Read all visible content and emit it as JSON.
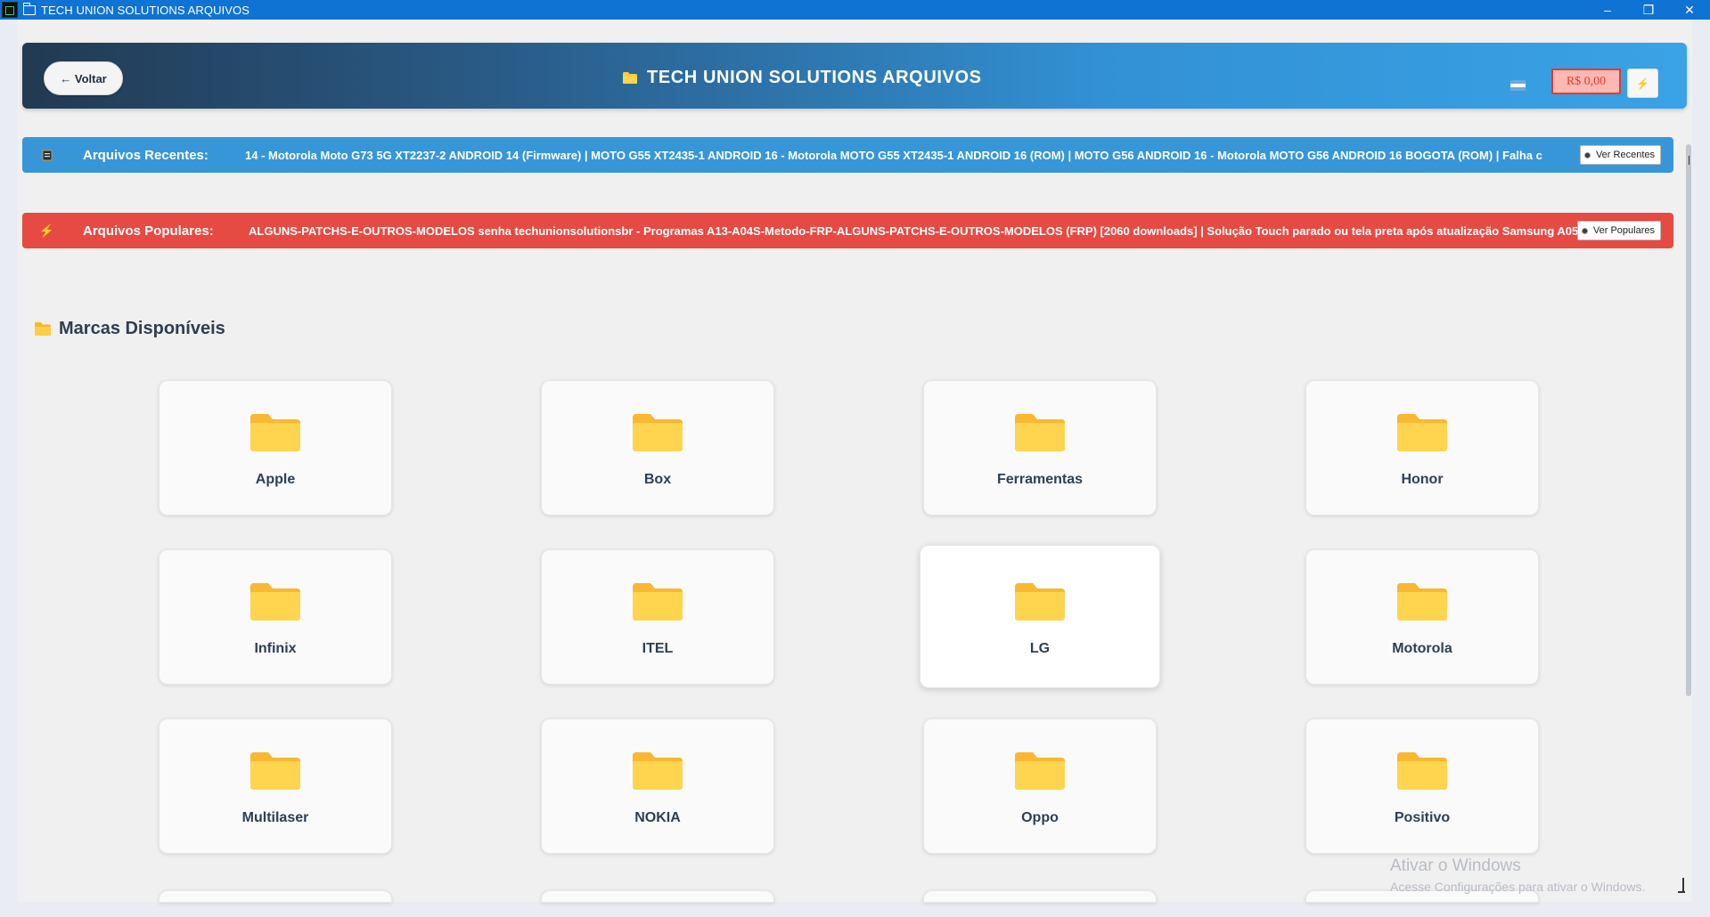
{
  "window": {
    "title": "TECH UNION SOLUTIONS ARQUIVOS",
    "controls": {
      "minimize": "–",
      "restore": "❐",
      "close": "✕"
    }
  },
  "header": {
    "back_label": "← Voltar",
    "title": "TECH UNION SOLUTIONS ARQUIVOS",
    "balance": "R$ 0,00",
    "bolt_glyph": "⚡",
    "accent_color": "#3291d4"
  },
  "tickers": {
    "recent": {
      "label": "Arquivos Recentes:",
      "text": "14 - Motorola Moto G73 5G XT2237-2 ANDROID 14 (Firmware) | MOTO G55 XT2435-1 ANDROID 16 - Motorola MOTO G55 XT2435-1 ANDROID 16 (ROM) | MOTO G56 ANDROID 16 - Motorola MOTO G56 ANDROID 16 BOGOTA (ROM) | Falha c",
      "button": "Ver Recentes",
      "color": "#3796d7"
    },
    "popular": {
      "label": "Arquivos Populares:",
      "text": "ALGUNS-PATCHS-E-OUTROS-MODELOS senha techunionsolutionsbr - Programas A13-A04S-Metodo-FRP-ALGUNS-PATCHS-E-OUTROS-MODELOS (FRP) [2060 downloads] | Solução Touch parado ou tela preta após atualização Samsung A05",
      "button": "Ver Populares",
      "color": "#e54a43"
    }
  },
  "brands_section": {
    "title": "Marcas Disponíveis",
    "brands": [
      "Apple",
      "Box",
      "Ferramentas",
      "Honor",
      "Infinix",
      "ITEL",
      "LG",
      "Motorola",
      "Multilaser",
      "NOKIA",
      "Oppo",
      "Positivo"
    ]
  },
  "watermark": {
    "title": "Ativar o Windows",
    "subtitle": "Acesse Configurações para ativar o Windows."
  }
}
